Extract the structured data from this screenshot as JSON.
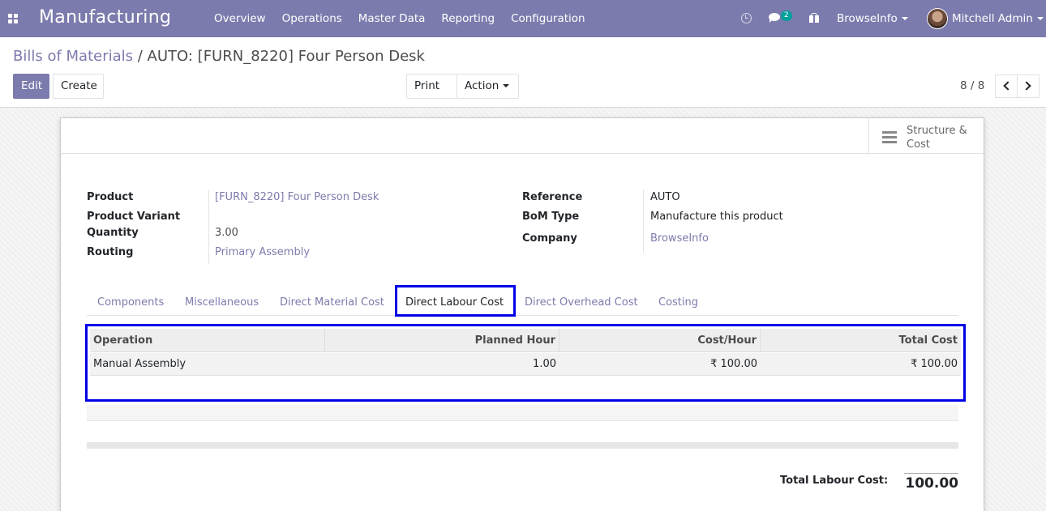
{
  "navbar": {
    "app_title": "Manufacturing",
    "menu": [
      "Overview",
      "Operations",
      "Master Data",
      "Reporting",
      "Configuration"
    ],
    "chat_count": "2",
    "company": "BrowseInfo",
    "user": "Mitchell Admin",
    "color": "#7c7bad"
  },
  "breadcrumb": {
    "parent": "Bills of Materials",
    "separator": " / ",
    "current": "AUTO: [FURN_8220] Four Person Desk"
  },
  "toolbar": {
    "edit": "Edit",
    "create": "Create",
    "print": "Print",
    "action": "Action",
    "pager": "8 / 8"
  },
  "stat_button": {
    "line1": "Structure &",
    "line2": "Cost"
  },
  "form": {
    "product_label": "Product",
    "product_value": "[FURN_8220] Four Person Desk",
    "variant_label": "Product Variant",
    "quantity_label": "Quantity",
    "quantity_value": "3.00",
    "routing_label": "Routing",
    "routing_value": "Primary Assembly",
    "reference_label": "Reference",
    "reference_value": "AUTO",
    "bom_type_label": "BoM Type",
    "bom_type_value": "Manufacture this product",
    "company_label": "Company",
    "company_value": "BrowseInfo"
  },
  "tabs": [
    "Components",
    "Miscellaneous",
    "Direct Material Cost",
    "Direct Labour Cost",
    "Direct Overhead Cost",
    "Costing"
  ],
  "active_tab": "Direct Labour Cost",
  "table": {
    "headers": [
      "Operation",
      "Planned Hour",
      "Cost/Hour",
      "Total Cost"
    ],
    "rows": [
      [
        "Manual Assembly",
        "1.00",
        "₹ 100.00",
        "₹ 100.00"
      ]
    ]
  },
  "totals": {
    "label": "Total Labour Cost:",
    "value": "100.00"
  },
  "highlight_color": "#0000e6"
}
